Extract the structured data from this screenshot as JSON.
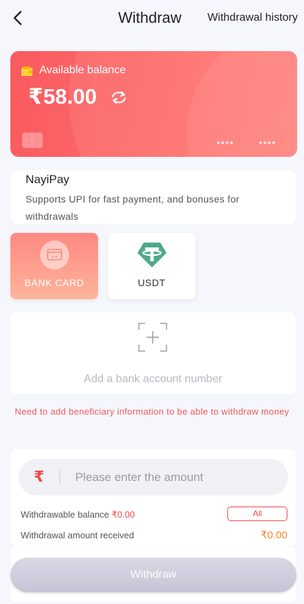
{
  "header": {
    "title": "Withdraw",
    "history_label": "Withdrawal history",
    "back_icon": "chevron-left-icon"
  },
  "balance_card": {
    "label": "Available balance",
    "amount": "₹58.00",
    "card_number_left": "****",
    "card_number_right": "****",
    "icons": [
      "wallet-icon",
      "refresh-icon",
      "card-chip-icon"
    ],
    "gradient_start": "#fa5a5f",
    "gradient_end": "#ff7b74"
  },
  "pay_channel": {
    "name": "NayiPay",
    "description": "Supports UPI for fast payment, and bonuses for withdrawals"
  },
  "methods": [
    {
      "label": "BANK CARD",
      "active": true,
      "icon": "bank-card-icon"
    },
    {
      "label": "USDT",
      "active": false,
      "icon": "tether-icon"
    }
  ],
  "add_account": {
    "label": "Add a bank account number",
    "icon": "add-box-icon"
  },
  "warning": "Need to add beneficiary information to be able to withdraw money",
  "amount_form": {
    "currency_symbol": "₹",
    "placeholder": "Please enter the amount",
    "withdrawable_label": "Withdrawable balance",
    "withdrawable_value": "₹0.00",
    "all_label": "All",
    "received_label": "Withdrawal amount received",
    "received_value": "₹0.00"
  },
  "submit_label": "Withdraw",
  "colors": {
    "accent_red": "#f04848",
    "orange": "#f5892a",
    "tether_green": "#50a98c",
    "disabled_button": "#c5c5d6"
  }
}
